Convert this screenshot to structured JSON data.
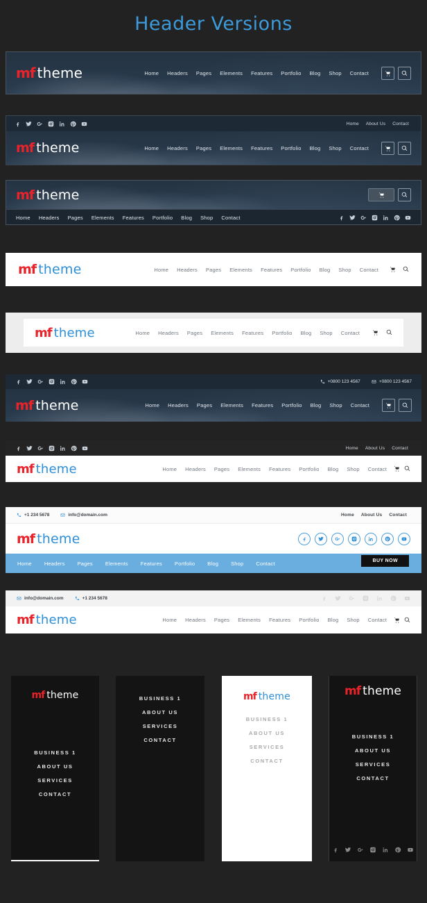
{
  "page": {
    "title": "Header Versions",
    "title_color": "#3d9bdb",
    "background": "#222222"
  },
  "brand": {
    "mark": "mf",
    "word": "theme",
    "mark_color": "#e8232a",
    "word_color_light": "#ffffff",
    "word_color_blue": "#2e8fd8"
  },
  "main_nav": [
    {
      "label": "Home"
    },
    {
      "label": "Headers"
    },
    {
      "label": "Pages"
    },
    {
      "label": "Elements"
    },
    {
      "label": "Features"
    },
    {
      "label": "Portfolio"
    },
    {
      "label": "Blog"
    },
    {
      "label": "Shop"
    },
    {
      "label": "Contact"
    }
  ],
  "top_links": [
    {
      "label": "Home"
    },
    {
      "label": "About Us"
    },
    {
      "label": "Contact"
    }
  ],
  "social": [
    {
      "name": "facebook-icon"
    },
    {
      "name": "twitter-icon"
    },
    {
      "name": "google-plus-icon"
    },
    {
      "name": "instagram-icon"
    },
    {
      "name": "linkedin-icon"
    },
    {
      "name": "pinterest-icon"
    },
    {
      "name": "youtube-icon"
    }
  ],
  "actions": {
    "cart": "cart-icon",
    "search": "search-icon"
  },
  "contact": {
    "phone_long": "+0800 123 4567",
    "email_long": "+0800 123 4567",
    "phone_short": "+1 234 5678",
    "email": "info@domain.com"
  },
  "buy_now": {
    "label": "BUY NOW",
    "bar_color": "#6aaee0"
  },
  "vertical_menu": [
    {
      "label": "BUSINESS 1"
    },
    {
      "label": "ABOUT US"
    },
    {
      "label": "SERVICES"
    },
    {
      "label": "CONTACT"
    }
  ],
  "headers": [
    {
      "id": "header-1",
      "style": "dark-photo-inline"
    },
    {
      "id": "header-2",
      "style": "dark-photo-with-topbar"
    },
    {
      "id": "header-3",
      "style": "dark-photo-split-nav"
    },
    {
      "id": "header-4",
      "style": "white-full"
    },
    {
      "id": "header-5",
      "style": "white-boxed"
    },
    {
      "id": "header-6",
      "style": "dark-photo-contact-topbar"
    },
    {
      "id": "header-7",
      "style": "white-with-dark-topbar"
    },
    {
      "id": "header-8",
      "style": "white-with-blue-nav"
    },
    {
      "id": "header-9",
      "style": "white-with-gray-topbar"
    }
  ],
  "panels": [
    {
      "id": "panel-1",
      "theme": "dark",
      "has_logo": true,
      "has_social": false
    },
    {
      "id": "panel-2",
      "theme": "dark",
      "has_logo": false,
      "has_social": false
    },
    {
      "id": "panel-3",
      "theme": "light",
      "has_logo": true,
      "has_social": false
    },
    {
      "id": "panel-4",
      "theme": "dark",
      "has_logo": true,
      "has_social": true
    }
  ]
}
